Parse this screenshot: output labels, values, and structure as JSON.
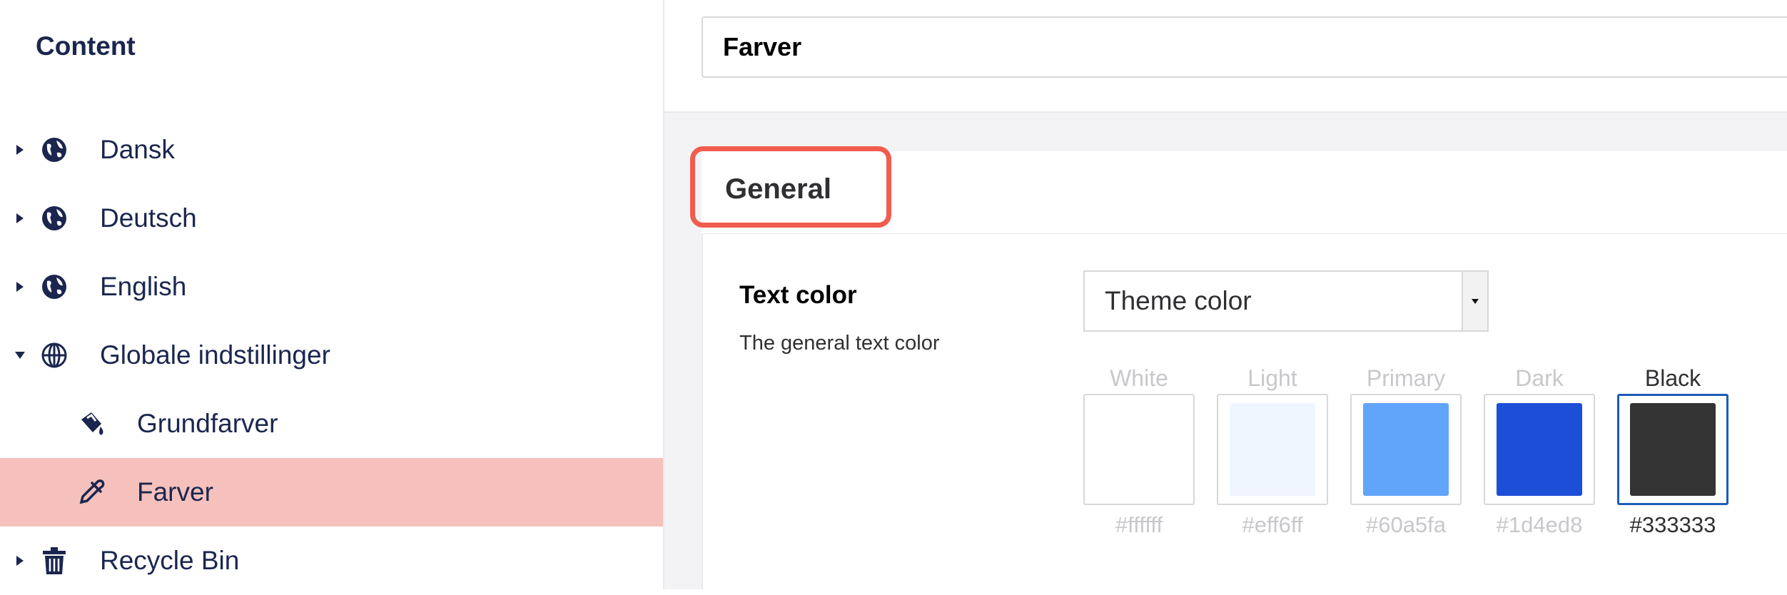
{
  "sidebar": {
    "title": "Content",
    "items": [
      {
        "label": "Dansk",
        "icon": "globe-icon",
        "expanded": false
      },
      {
        "label": "Deutsch",
        "icon": "globe-icon",
        "expanded": false
      },
      {
        "label": "English",
        "icon": "globe-icon",
        "expanded": false
      },
      {
        "label": "Globale indstillinger",
        "icon": "globe-grid-icon",
        "expanded": true
      },
      {
        "label": "Grundfarver",
        "icon": "paint-bucket-icon"
      },
      {
        "label": "Farver",
        "icon": "eyedropper-icon",
        "active": true
      },
      {
        "label": "Recycle Bin",
        "icon": "trash-icon",
        "expanded": false
      }
    ]
  },
  "editor": {
    "name_value": "Farver",
    "group_tab": "General",
    "property": {
      "label": "Text color",
      "description": "The general text color",
      "select_value": "Theme color",
      "swatches": [
        {
          "name": "White",
          "hex": "#ffffff",
          "color": "#ffffff",
          "selected": false
        },
        {
          "name": "Light",
          "hex": "#eff6ff",
          "color": "#eff6ff",
          "selected": false
        },
        {
          "name": "Primary",
          "hex": "#60a5fa",
          "color": "#60a5fa",
          "selected": false
        },
        {
          "name": "Dark",
          "hex": "#1d4ed8",
          "color": "#1d4ed8",
          "selected": false
        },
        {
          "name": "Black",
          "hex": "#333333",
          "color": "#333333",
          "selected": true
        }
      ]
    }
  },
  "colors": {
    "active_row": "#f6c1bc",
    "highlight": "#f05d4f",
    "selected_border": "#1b5db8",
    "nav_text": "#1b264f"
  }
}
